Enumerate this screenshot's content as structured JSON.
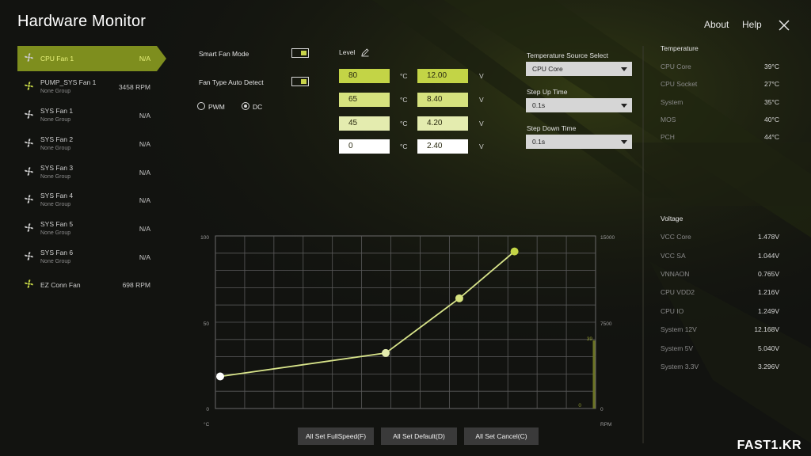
{
  "app": {
    "title": "Hardware Monitor"
  },
  "nav": {
    "about": "About",
    "help": "Help"
  },
  "fans": [
    {
      "name": "CPU Fan 1",
      "group": "",
      "value": "N/A",
      "active": true
    },
    {
      "name": "PUMP_SYS Fan 1",
      "group": "None Group",
      "value": "3458 RPM"
    },
    {
      "name": "SYS Fan 1",
      "group": "None Group",
      "value": "N/A"
    },
    {
      "name": "SYS Fan 2",
      "group": "None Group",
      "value": "N/A"
    },
    {
      "name": "SYS Fan 3",
      "group": "None Group",
      "value": "N/A"
    },
    {
      "name": "SYS Fan 4",
      "group": "None Group",
      "value": "N/A"
    },
    {
      "name": "SYS Fan 5",
      "group": "None Group",
      "value": "N/A"
    },
    {
      "name": "SYS Fan 6",
      "group": "None Group",
      "value": "N/A"
    },
    {
      "name": "EZ Conn Fan",
      "group": "",
      "value": "698 RPM"
    }
  ],
  "controls": {
    "smart_fan_mode": "Smart Fan Mode",
    "fan_type_auto": "Fan Type Auto Detect",
    "pwm": "PWM",
    "dc": "DC",
    "level": "Level"
  },
  "levels": [
    {
      "temp": "80",
      "temp_unit": "°C",
      "volt": "12.00",
      "volt_unit": "V",
      "color": "#c3d446"
    },
    {
      "temp": "65",
      "temp_unit": "°C",
      "volt": "8.40",
      "volt_unit": "V",
      "color": "#d6e27e"
    },
    {
      "temp": "45",
      "temp_unit": "°C",
      "volt": "4.20",
      "volt_unit": "V",
      "color": "#e4ecaf"
    },
    {
      "temp": "0",
      "temp_unit": "°C",
      "volt": "2.40",
      "volt_unit": "V",
      "color": "#ffffff"
    }
  ],
  "settings": {
    "temp_source_label": "Temperature Source Select",
    "temp_source_value": "CPU Core",
    "step_up_label": "Step Up Time",
    "step_up_value": "0.1s",
    "step_down_label": "Step Down Time",
    "step_down_value": "0.1s"
  },
  "temperature": {
    "title": "Temperature",
    "items": [
      {
        "label": "CPU Core",
        "value": "39°C"
      },
      {
        "label": "CPU Socket",
        "value": "27°C"
      },
      {
        "label": "System",
        "value": "35°C"
      },
      {
        "label": "MOS",
        "value": "40°C"
      },
      {
        "label": "PCH",
        "value": "44°C"
      }
    ]
  },
  "voltage": {
    "title": "Voltage",
    "items": [
      {
        "label": "VCC Core",
        "value": "1.478V"
      },
      {
        "label": "VCC SA",
        "value": "1.044V"
      },
      {
        "label": "VNNAON",
        "value": "0.765V"
      },
      {
        "label": "CPU VDD2",
        "value": "1.216V"
      },
      {
        "label": "CPU IO",
        "value": "1.249V"
      },
      {
        "label": "System 12V",
        "value": "12.168V"
      },
      {
        "label": "System 5V",
        "value": "5.040V"
      },
      {
        "label": "System 3.3V",
        "value": "3.296V"
      }
    ]
  },
  "chart_data": {
    "type": "line",
    "x": [
      0,
      45,
      65,
      80
    ],
    "y": [
      2.4,
      4.2,
      8.4,
      12.0
    ],
    "xlabel": "°C",
    "y_left_ticks": [
      "100",
      "50",
      "0"
    ],
    "y_right_ticks": [
      "15000",
      "7500",
      "0"
    ],
    "y_right_label": "RPM",
    "current_temp_label": "39",
    "current_rpm_label": "0",
    "grid": true
  },
  "buttons": {
    "full_speed": "All Set FullSpeed(F)",
    "default": "All Set Default(D)",
    "cancel": "All Set Cancel(C)"
  },
  "watermark": "FAST1.KR",
  "colors": {
    "accent": "#7e8e1e",
    "highlight": "#e8f27a",
    "curve": "#d8e48a"
  }
}
